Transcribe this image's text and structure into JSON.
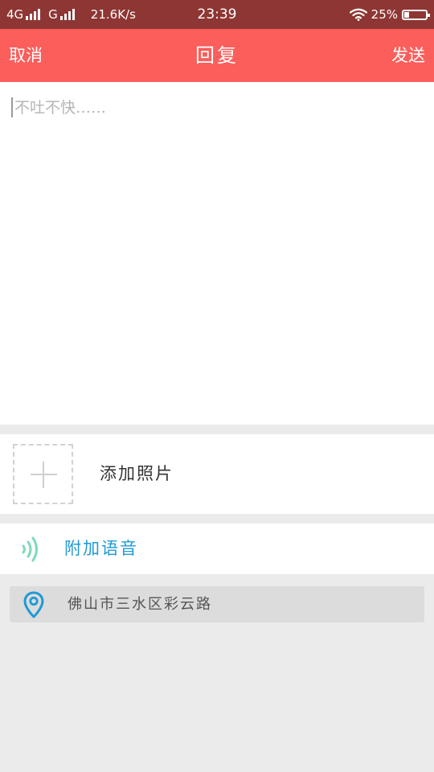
{
  "status_bar": {
    "network1": "4G",
    "network2": "G",
    "speed": "21.6K/s",
    "time": "23:39",
    "battery_text": "25%",
    "battery_level": 0.25
  },
  "nav": {
    "cancel_label": "取消",
    "title": "回复",
    "send_label": "发送"
  },
  "reply": {
    "placeholder": "不吐不快……",
    "value": ""
  },
  "photo": {
    "add_label": "添加照片"
  },
  "voice": {
    "label": "附加语音"
  },
  "location": {
    "text": "佛山市三水区彩云路"
  },
  "colors": {
    "status_bar": "#8e3633",
    "nav_bar": "#fb5e5b",
    "voice_accent": "#1e9ad6",
    "voice_icon": "#7dd9bd",
    "pin_icon": "#1e9ad6",
    "page_background": "#ebebeb"
  },
  "icons": {
    "voice": "sound-wave-icon",
    "location": "location-pin-icon",
    "add_photo": "plus-icon"
  }
}
